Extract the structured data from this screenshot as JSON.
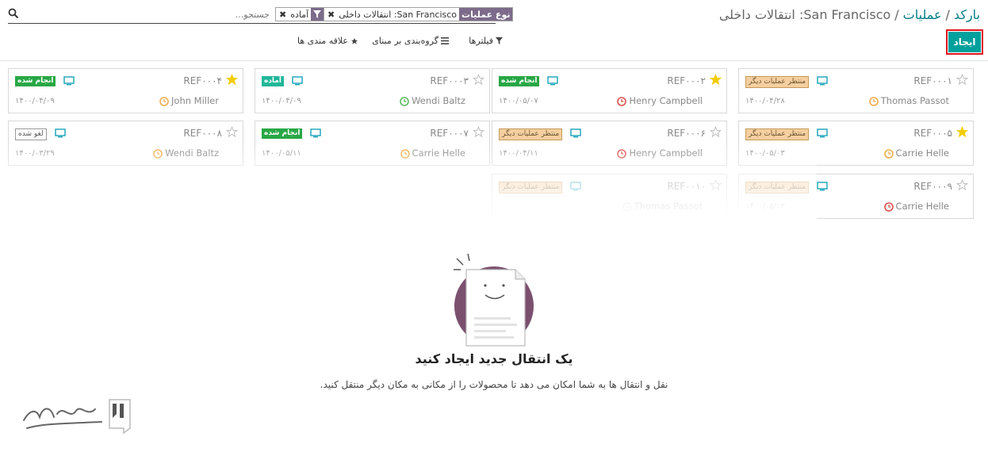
{
  "breadcrumb": {
    "root": "بارکد",
    "middle": "عملیات",
    "current": "San Francisco: انتقالات داخلی"
  },
  "actions": {
    "create_label": "ایجاد"
  },
  "search": {
    "placeholder": "جستجو...",
    "facets": [
      {
        "category": "نوع عملیات",
        "value": "San Francisco: انتقالات داخلی"
      },
      {
        "category": "filter-icon",
        "value": "آماده"
      }
    ]
  },
  "toolbar": {
    "filters_label": "فیلترها",
    "groupby_label": "گروه‌بندی بر مبنای",
    "favorites_label": "علاقه مندی ها"
  },
  "cards": [
    {
      "ref": "REF۰۰۰۱",
      "starred": false,
      "status": "منتظر عملیات دیگر",
      "status_type": "waiting",
      "contact": "Thomas Passot",
      "date": "۱۴۰۰/۰۴/۲۸",
      "clock_color": "#f0ad4e"
    },
    {
      "ref": "REF۰۰۰۲",
      "starred": true,
      "status": "انجام شده",
      "status_type": "done",
      "contact": "Henry Campbell",
      "date": "۱۴۰۰/۰۵/۰۷",
      "clock_color": "#d9534f"
    },
    {
      "ref": "REF۰۰۰۳",
      "starred": false,
      "status": "آماده",
      "status_type": "ready",
      "contact": "Wendi Baltz",
      "date": "۱۴۰۰/۰۴/۰۹",
      "clock_color": "#5cb85c"
    },
    {
      "ref": "REF۰۰۰۴",
      "starred": true,
      "status": "انجام شده",
      "status_type": "done",
      "contact": "John Miller",
      "date": "۱۴۰۰/۰۴/۰۹",
      "clock_color": "#f0ad4e"
    },
    {
      "ref": "REF۰۰۰۵",
      "starred": true,
      "status": "منتظر عملیات دیگر",
      "status_type": "waiting",
      "contact": "Carrie Helle",
      "date": "۱۴۰۰/۰۵/۰۳",
      "clock_color": "#f0ad4e"
    },
    {
      "ref": "REF۰۰۰۶",
      "starred": false,
      "status": "منتظر عملیات دیگر",
      "status_type": "waiting",
      "contact": "Henry Campbell",
      "date": "۱۴۰۰/۰۴/۱۱",
      "clock_color": "#d9534f"
    },
    {
      "ref": "REF۰۰۰۷",
      "starred": false,
      "status": "انجام شده",
      "status_type": "done",
      "contact": "Carrie Helle",
      "date": "۱۴۰۰/۰۵/۱۱",
      "clock_color": "#f0ad4e"
    },
    {
      "ref": "REF۰۰۰۸",
      "starred": false,
      "status": "لغو شده",
      "status_type": "cancel",
      "contact": "Wendi Baltz",
      "date": "۱۴۰۰/۰۳/۲۹",
      "clock_color": "#f0ad4e"
    },
    {
      "ref": "REF۰۰۰۹",
      "starred": false,
      "status": "منتظر عملیات دیگر",
      "status_type": "waiting",
      "contact": "Carrie Helle",
      "date": "۱۴۰۰/۰۵/۱۳",
      "clock_color": "#d9534f"
    },
    {
      "ref": "REF۰۰۱۰",
      "starred": false,
      "status": "منتظر عملیات دیگر",
      "status_type": "waiting",
      "contact": "Thomas Passot",
      "date": "",
      "clock_color": "#cccccc"
    }
  ],
  "empty_state": {
    "title": "یک انتقال جدید ایجاد کنید",
    "text": "نقل و انتقال ها به شما امکان می دهد تا محصولات را از مکانی به مکان دیگر منتقل کنید."
  },
  "colors": {
    "accent": "#017e84",
    "primary_button": "#00a09d",
    "facet_category": "#7c6b8a",
    "highlight_border": "#e3141c"
  }
}
